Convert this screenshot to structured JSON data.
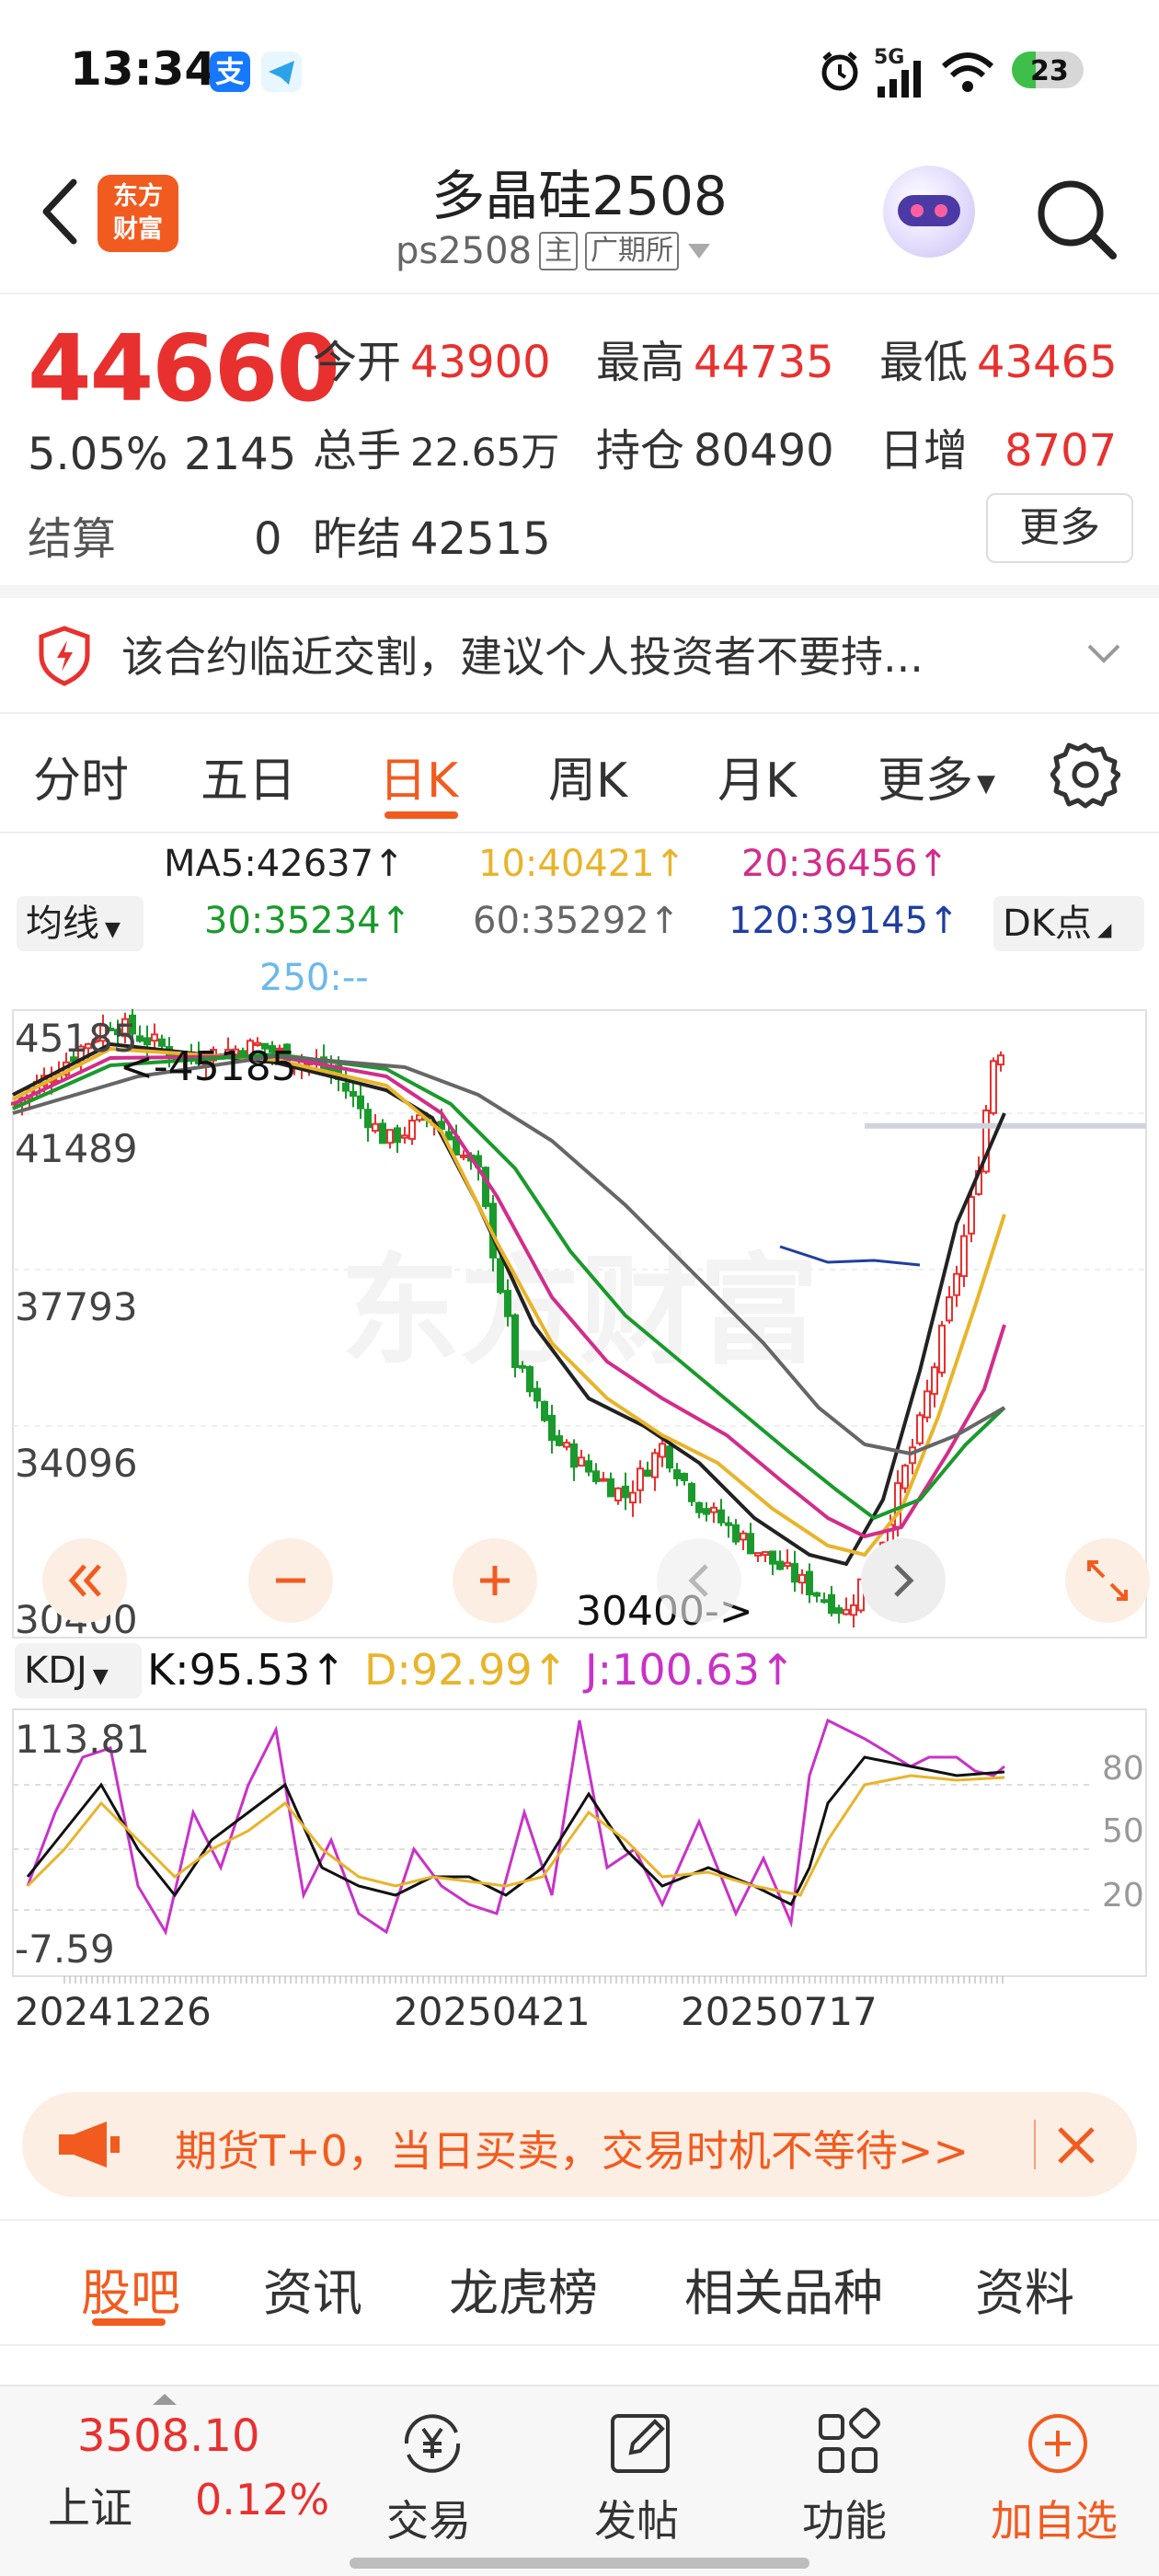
{
  "status_bar": {
    "time": "13:34",
    "network": "5G",
    "battery": "23"
  },
  "header": {
    "logo_line1": "东方",
    "logo_line2": "财富",
    "title": "多晶硅2508",
    "code": "ps2508",
    "tag_main": "主",
    "exchange": "广期所"
  },
  "quote": {
    "price": "44660",
    "change_pct": "5.05%",
    "change": "2145",
    "stats": [
      {
        "label": "今开",
        "value": "43900"
      },
      {
        "label": "最高",
        "value": "44735"
      },
      {
        "label": "最低",
        "value": "43465"
      },
      {
        "label": "总手",
        "value": "22.65万"
      },
      {
        "label": "持仓",
        "value": "80490"
      },
      {
        "label": "日增",
        "value": "8707"
      },
      {
        "label": "结算",
        "value": "0"
      },
      {
        "label": "昨结",
        "value": "42515"
      }
    ],
    "more_label": "更多"
  },
  "warning": {
    "text": "该合约临近交割，建议个人投资者不要持..."
  },
  "tabs": [
    "分时",
    "五日",
    "日K",
    "周K",
    "月K",
    "更多"
  ],
  "active_tab": "日K",
  "indicators": {
    "ma_selector": "均线",
    "ma5": "MA5:42637↑",
    "ma10": "10:40421↑",
    "ma20": "20:36456↑",
    "ma30": "30:35234↑",
    "ma60": "60:35292↑",
    "ma120": "120:39145↑",
    "ma250": "250:--",
    "dk_label": "DK点",
    "colors": {
      "ma5": "#222222",
      "ma10": "#e8b42a",
      "ma20": "#d22d8a",
      "ma30": "#1a9a2c",
      "ma60": "#666666",
      "ma120": "#1f3fa0",
      "ma250": "#6bb8ec"
    }
  },
  "chart": {
    "y_labels": [
      "45185",
      "41489",
      "37793",
      "34096",
      "30400"
    ],
    "high_marker": "45185",
    "low_marker": "30400->",
    "kdj_selector": "KDJ",
    "kdj_k": "K:95.53↑",
    "kdj_d": "D:92.99↑",
    "kdj_j": "J:100.63↑",
    "kdj_max": "113.81",
    "kdj_min": "-7.59",
    "kdj_levels": [
      "80",
      "50",
      "20"
    ],
    "dates": [
      "20241226",
      "20250421",
      "20250717"
    ],
    "up_color": "#e8312f",
    "down_color": "#1a9a2c",
    "watermark": "东方财富"
  },
  "promo": {
    "text": "期货T+0，当日买卖，交易时机不等待>>"
  },
  "bottom_tabs": [
    "股吧",
    "资讯",
    "龙虎榜",
    "相关品种",
    "资料"
  ],
  "index_ticker": {
    "value": "3508.10",
    "name": "上证",
    "change": "0.12%"
  },
  "nav": [
    {
      "label": "交易",
      "icon": "yen-exchange-icon"
    },
    {
      "label": "发帖",
      "icon": "edit-icon"
    },
    {
      "label": "功能",
      "icon": "grid-icon"
    },
    {
      "label": "加自选",
      "icon": "add-circle-icon"
    }
  ]
}
